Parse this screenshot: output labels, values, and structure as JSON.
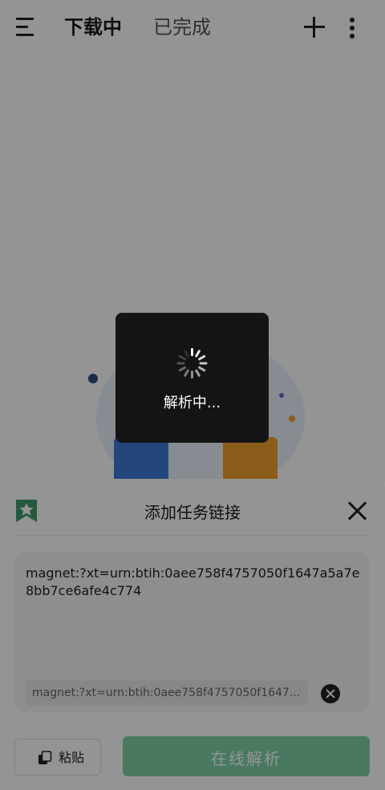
{
  "header": {
    "tabs": [
      {
        "label": "下载中",
        "active": true
      },
      {
        "label": "已完成",
        "active": false
      }
    ],
    "icons": [
      "menu-icon",
      "plus-icon",
      "more-vertical-icon"
    ]
  },
  "sheet": {
    "title": "添加任务链接",
    "link_value": "magnet:?xt=urn:btih:0aee758f4757050f1647a5a7e8bb7ce6afe4c774",
    "history_chip": "magnet:?xt=urn:btih:0aee758f4757050f1647...",
    "paste_label": "粘贴",
    "parse_label": "在线解析",
    "colors": {
      "bookmark": "#3f9a6e",
      "parse_button": "#7fd2a8"
    }
  },
  "loading": {
    "label": "解析中..."
  }
}
